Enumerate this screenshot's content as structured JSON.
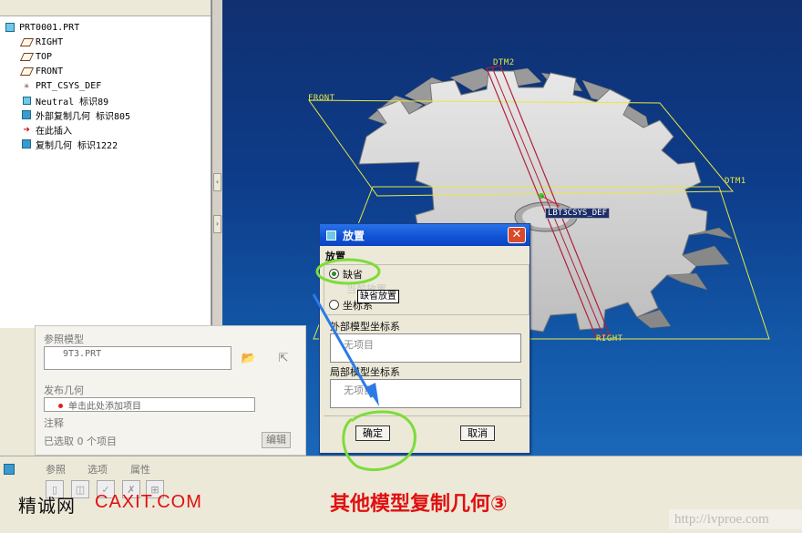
{
  "model_tree": {
    "items": [
      {
        "label": "PRT0001.PRT",
        "icon": "part-icon"
      },
      {
        "label": "RIGHT",
        "icon": "datum-plane-icon"
      },
      {
        "label": "TOP",
        "icon": "datum-plane-icon"
      },
      {
        "label": "FRONT",
        "icon": "datum-plane-icon"
      },
      {
        "label": "PRT_CSYS_DEF",
        "icon": "coordinate-system-icon"
      },
      {
        "label": "Neutral 标识89",
        "icon": "neutral-icon"
      },
      {
        "label": "外部复制几何 标识805",
        "icon": "copy-geometry-icon"
      },
      {
        "label": "在此插入",
        "icon": "insert-here-arrow-icon"
      },
      {
        "label": "复制几何 标识1222",
        "icon": "copy-geometry-icon"
      }
    ]
  },
  "viewport": {
    "labels": {
      "dtm2": "DTM2",
      "front": "FRONT",
      "dtm1": "DTM1",
      "right": "RIGHT",
      "csys": "LBT3CSYS_DEF"
    }
  },
  "dashboard": {
    "ref_model_label": "参照模型",
    "ref_model_value": "9T3.PRT",
    "publish_geom_label": "发布几何",
    "publish_geom_placeholder": "单击此处添加项目",
    "notes_label": "注释",
    "selected_text": "已选取 0 个项目",
    "details_button": "编辑"
  },
  "bottom_tabs": [
    "参照",
    "选项",
    "属性"
  ],
  "dialog": {
    "title": "放置",
    "section_label": "放置",
    "radio_default": "缺省",
    "radio_default_selected": true,
    "radio_csys": "坐标系",
    "tooltip": "缺省放置",
    "tooltip_ghost": "当前放置",
    "external_csys_label": "外部模型坐标系",
    "external_csys_value": "无项目",
    "local_csys_label": "局部模型坐标系",
    "local_csys_value": "无项目",
    "ok_button": "确定",
    "cancel_button": "取消"
  },
  "branding": {
    "left": "精诚网",
    "url": "CAXIT.COM",
    "title": "其他模型复制几何③",
    "watermark": "http://ivproe.com"
  },
  "colors": {
    "viewport_top": "#103070",
    "viewport_bottom": "#1a67b8",
    "datum_yellow": "#e8e840",
    "annotation_green": "#7ddc3a",
    "annotation_blue": "#2a7ae8",
    "brand_red": "#e01010"
  }
}
